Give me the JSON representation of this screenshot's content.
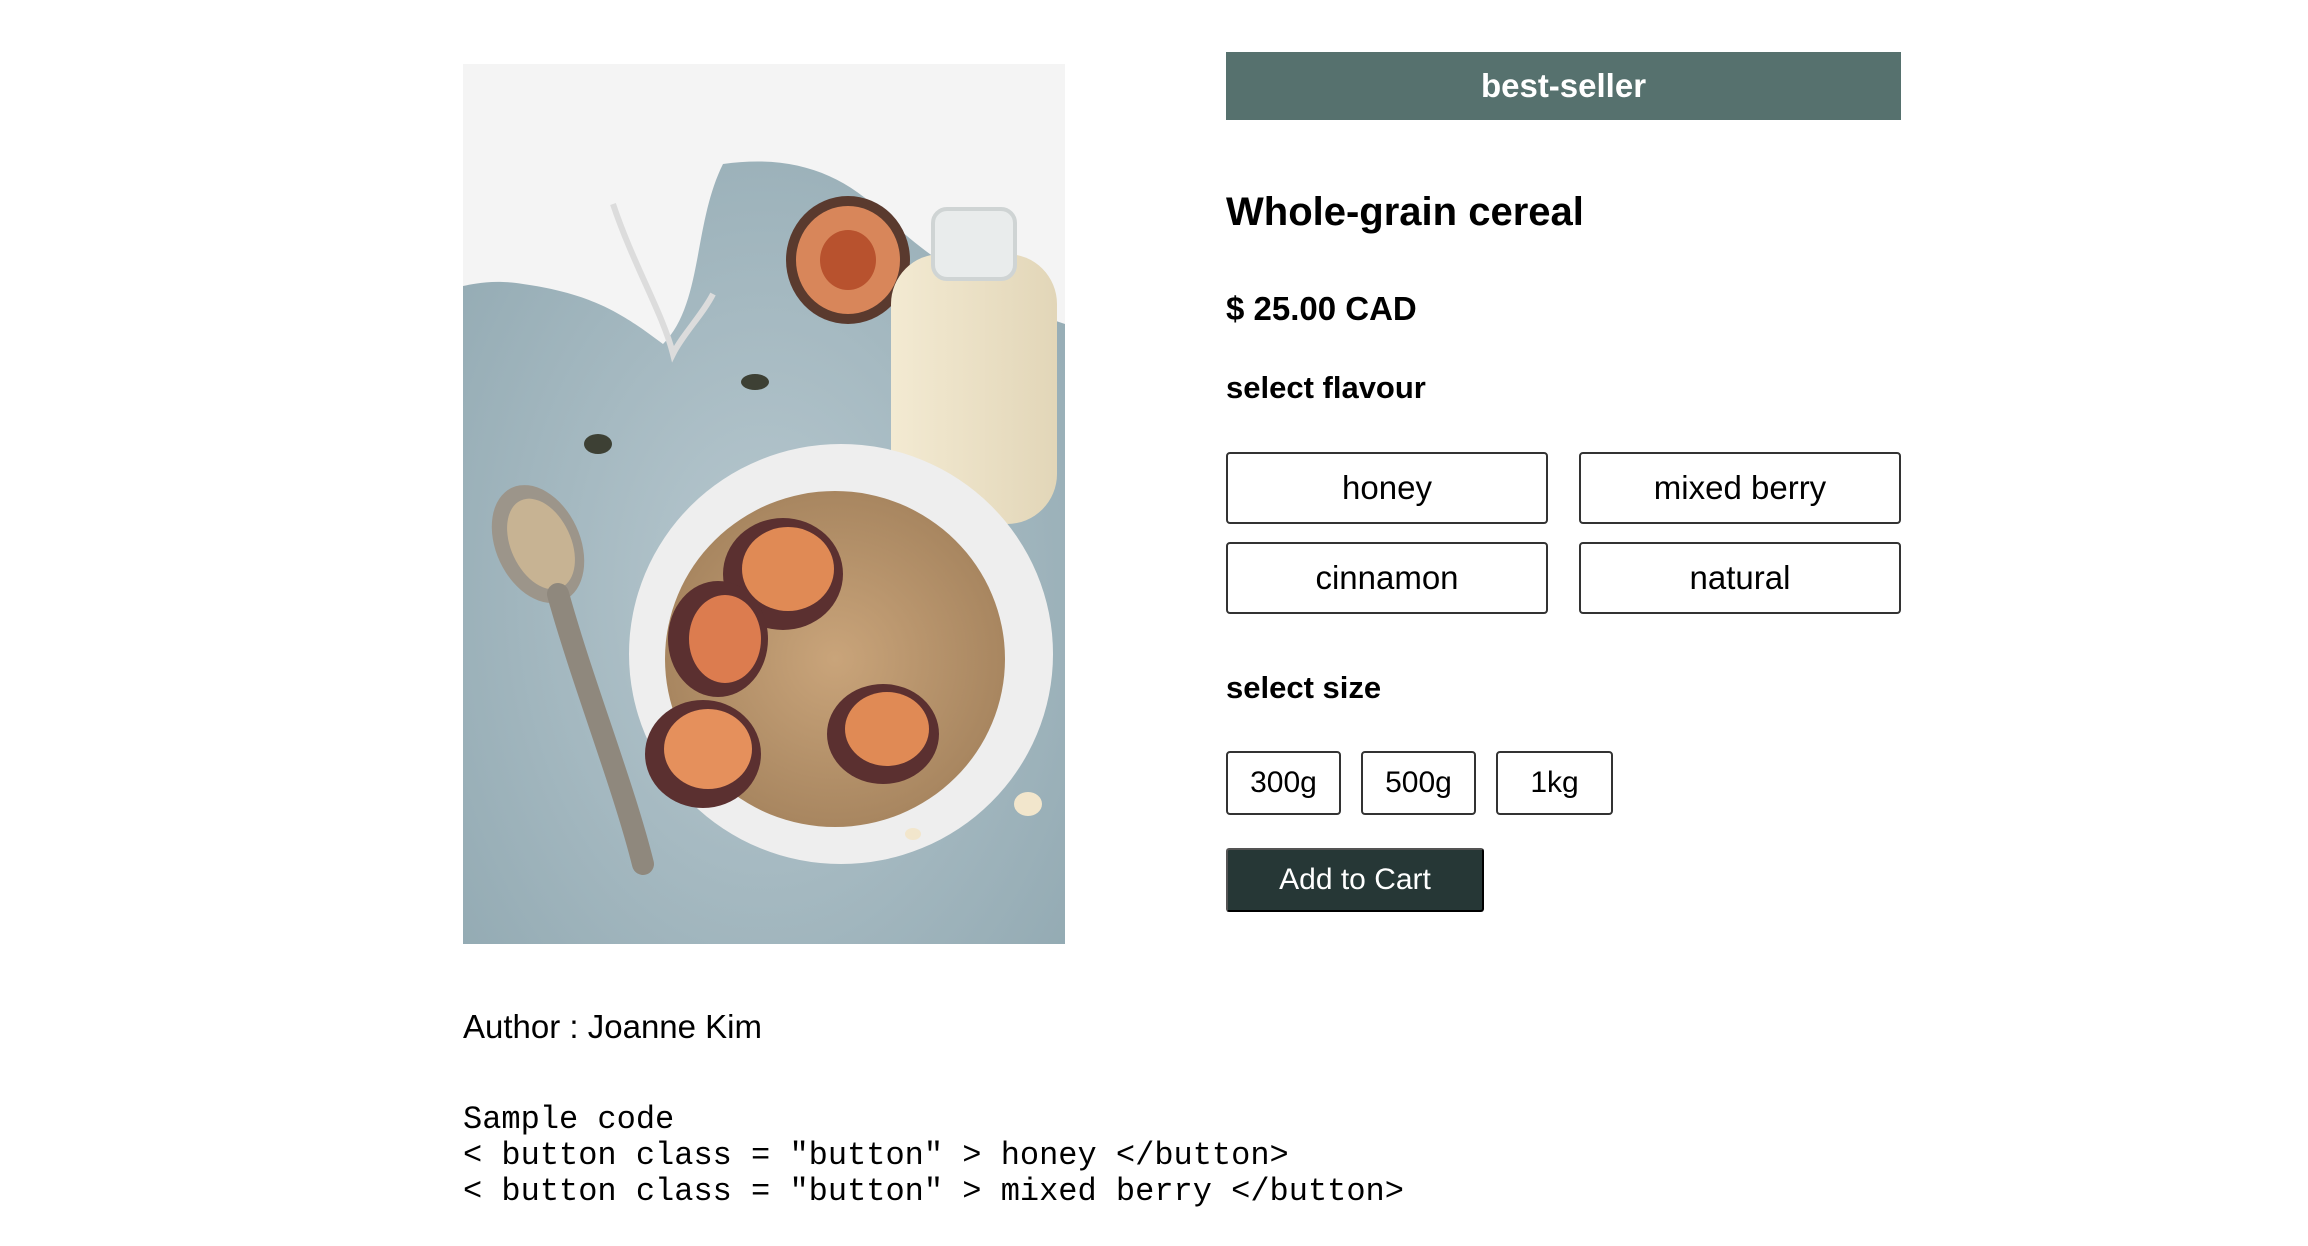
{
  "product": {
    "image_alt": "bowl of granola with figs, spoon and bottle of milk",
    "badge": "best-seller",
    "title": "Whole-grain cereal",
    "price": "$ 25.00 CAD"
  },
  "flavour": {
    "label": "select flavour",
    "options": [
      "honey",
      "mixed berry",
      "cinnamon",
      "natural"
    ]
  },
  "size": {
    "label": "select size",
    "options": [
      "300g",
      "500g",
      "1kg"
    ]
  },
  "cart": {
    "label": "Add to Cart"
  },
  "footer": {
    "author": "Author : Joanne Kim",
    "code_lines": [
      "Sample code",
      "< button class = \"button\" > honey </button>",
      "< button class = \"button\" > mixed berry </button>"
    ]
  },
  "colors": {
    "badge_bg": "#56716e",
    "cart_bg": "#263736"
  }
}
